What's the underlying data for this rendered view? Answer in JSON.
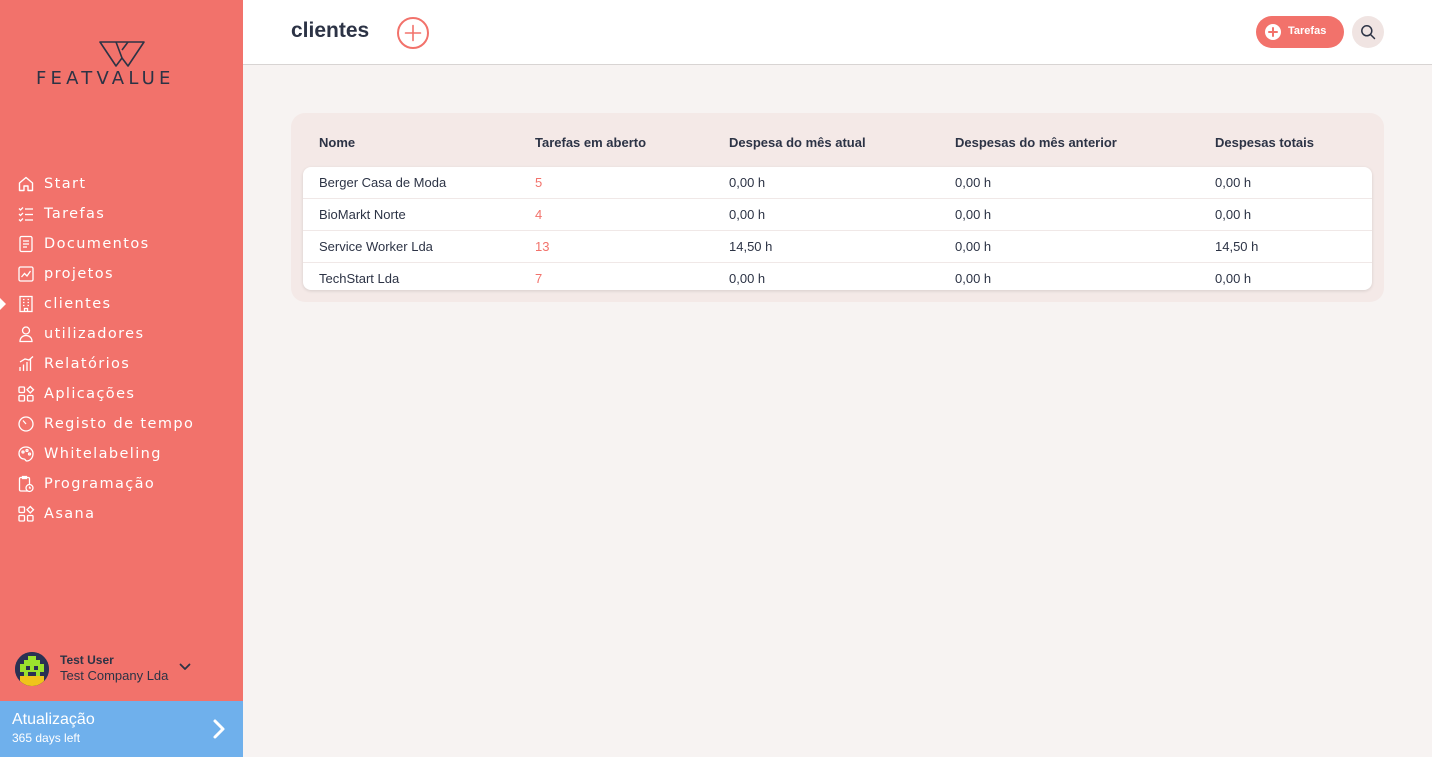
{
  "brand": {
    "name": "FEATVALUE"
  },
  "sidebar": {
    "items": [
      {
        "label": "Start",
        "icon": "home-icon"
      },
      {
        "label": "Tarefas",
        "icon": "task-list-icon"
      },
      {
        "label": "Documentos",
        "icon": "document-icon"
      },
      {
        "label": "projetos",
        "icon": "chart-icon"
      },
      {
        "label": "clientes",
        "icon": "building-icon",
        "active": true
      },
      {
        "label": "utilizadores",
        "icon": "user-icon"
      },
      {
        "label": "Relatórios",
        "icon": "bar-chart-icon"
      },
      {
        "label": "Aplicações",
        "icon": "apps-icon"
      },
      {
        "label": "Registo de tempo",
        "icon": "timer-icon"
      },
      {
        "label": "Whitelabeling",
        "icon": "palette-icon"
      },
      {
        "label": "Programação",
        "icon": "schedule-icon"
      },
      {
        "label": "Asana",
        "icon": "apps-icon"
      }
    ]
  },
  "user": {
    "name": "Test User",
    "company": "Test Company Lda"
  },
  "update": {
    "title": "Atualização",
    "subtitle": "365 days left"
  },
  "header": {
    "title": "clientes",
    "tasks_label": "Tarefas"
  },
  "table": {
    "columns": [
      "Nome",
      "Tarefas em aberto",
      "Despesa do mês atual",
      "Despesas do mês anterior",
      "Despesas totais"
    ],
    "rows": [
      {
        "name": "Berger Casa de Moda",
        "open": "5",
        "current": "0,00 h",
        "previous": "0,00 h",
        "total": "0,00 h"
      },
      {
        "name": "BioMarkt Norte",
        "open": "4",
        "current": "0,00 h",
        "previous": "0,00 h",
        "total": "0,00 h"
      },
      {
        "name": "Service Worker Lda",
        "open": "13",
        "current": "14,50 h",
        "previous": "0,00 h",
        "total": "14,50 h"
      },
      {
        "name": "TechStart Lda",
        "open": "7",
        "current": "0,00 h",
        "previous": "0,00 h",
        "total": "0,00 h"
      }
    ]
  },
  "colors": {
    "accent": "#f2726b",
    "update": "#6fb0ec",
    "text": "#2c3345"
  }
}
